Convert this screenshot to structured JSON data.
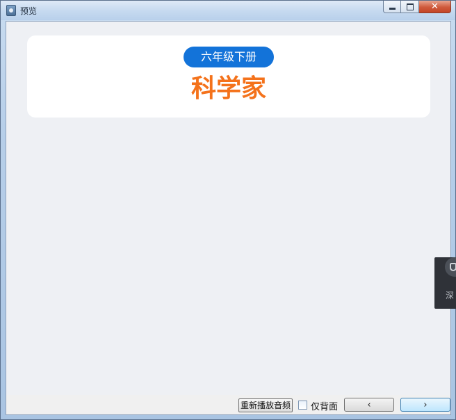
{
  "window": {
    "title": "预览",
    "controls": {
      "minimize": "",
      "maximize": "",
      "close": "✕"
    }
  },
  "card": {
    "grade": "六年级下册",
    "title": "科学家"
  },
  "bottom": {
    "replay_label": "重新播放音频",
    "back_only_label": "仅背面",
    "back_only_checked": false,
    "prev_label": "‹",
    "next_label": "›"
  },
  "side_widget": {
    "text": "深"
  },
  "colors": {
    "pill": "#1373d9",
    "title": "#f4721b",
    "client_bg": "#eef0f4"
  },
  "icons": {
    "app": "preview-app-icon",
    "widget": "shield-icon"
  }
}
